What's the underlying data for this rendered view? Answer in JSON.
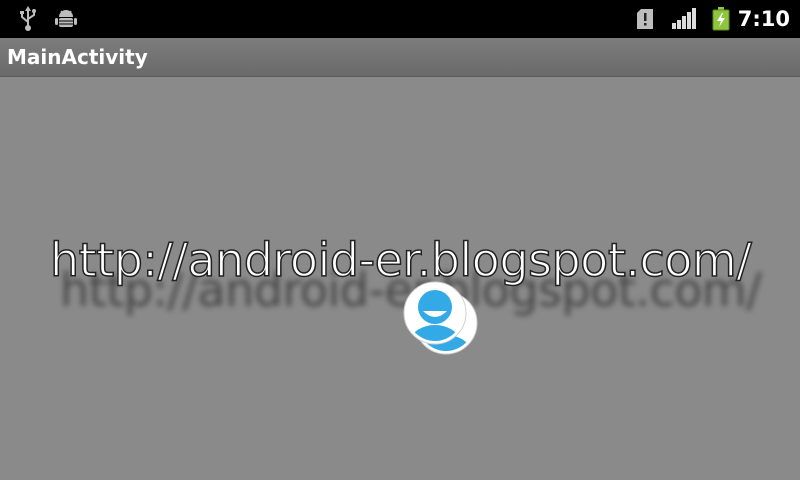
{
  "status_bar": {
    "time": "7:10",
    "icons": [
      "usb-icon",
      "debug-icon",
      "sd-card-icon",
      "signal-icon",
      "battery-icon"
    ],
    "battery_color": "#8ec63f"
  },
  "app": {
    "title": "MainActivity"
  },
  "content": {
    "url_text": "http://android-er.blogspot.com/",
    "avatar_color": "#33a9e6"
  }
}
